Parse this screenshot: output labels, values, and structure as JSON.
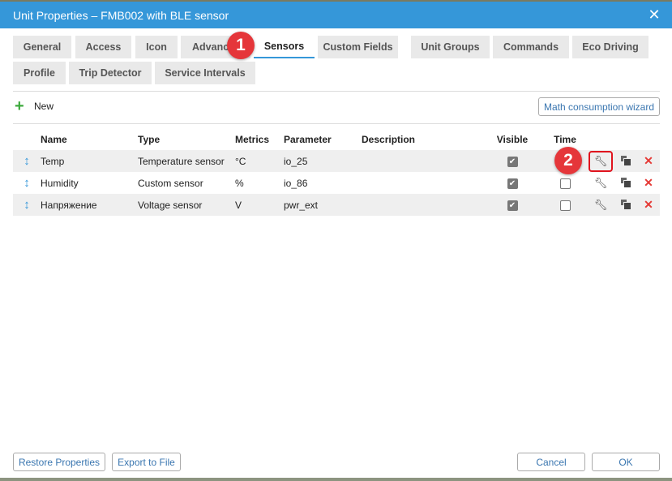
{
  "window": {
    "title": "Unit Properties – FMB002 with BLE sensor",
    "close_icon": "close-icon"
  },
  "tabs": [
    {
      "label": "General"
    },
    {
      "label": "Access"
    },
    {
      "label": "Icon"
    },
    {
      "label": "Advanced"
    },
    {
      "label": "Sensors",
      "active": true
    },
    {
      "label": "Custom Fields"
    },
    {
      "label": "Unit Groups"
    },
    {
      "label": "Commands"
    },
    {
      "label": "Eco Driving"
    },
    {
      "label": "Profile"
    },
    {
      "label": "Trip Detector"
    },
    {
      "label": "Service Intervals"
    }
  ],
  "toolbar": {
    "new_label": "New",
    "wizard_label": "Math consumption wizard"
  },
  "table": {
    "columns": [
      "",
      "Name",
      "Type",
      "Metrics",
      "Parameter",
      "Description",
      "Visible",
      "Time"
    ],
    "rows": [
      {
        "name": "Temp",
        "type": "Temperature sensor",
        "metrics": "°C",
        "parameter": "io_25",
        "description": "",
        "visible": true,
        "time": null
      },
      {
        "name": "Humidity",
        "type": "Custom sensor",
        "metrics": "%",
        "parameter": "io_86",
        "description": "",
        "visible": true,
        "time": false
      },
      {
        "name": "Напряжение",
        "type": "Voltage sensor",
        "metrics": "V",
        "parameter": "pwr_ext",
        "description": "",
        "visible": true,
        "time": false
      }
    ]
  },
  "annotations": {
    "badge1": "1",
    "badge2": "2"
  },
  "footer": {
    "restore_label": "Restore Properties",
    "export_label": "Export to File",
    "cancel_label": "Cancel",
    "ok_label": "OK"
  },
  "colors": {
    "accent": "#3597d9",
    "badge": "#e5363a",
    "delete": "#e53935",
    "add": "#3daa3d"
  }
}
